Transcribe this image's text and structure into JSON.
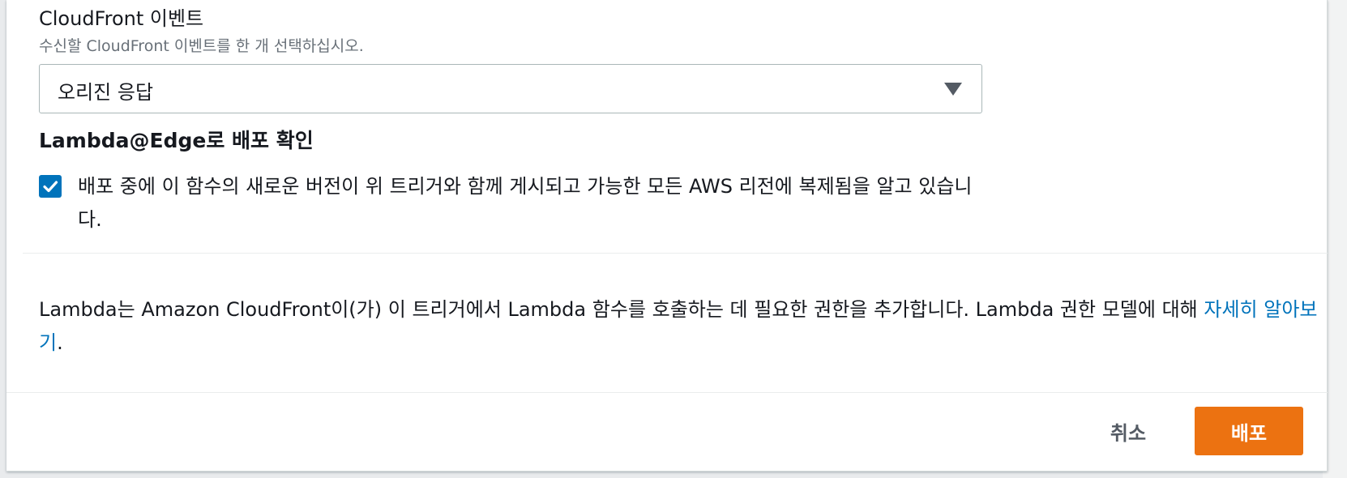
{
  "event_field": {
    "label": "CloudFront 이벤트",
    "description": "수신할 CloudFront 이벤트를 한 개 선택하십시오.",
    "selected_value": "오리진 응답"
  },
  "confirm_section": {
    "title": "Lambda@Edge로 배포 확인",
    "checked": true,
    "checkbox_label": "배포 중에 이 함수의 새로운 버전이 위 트리거와 함께 게시되고 가능한 모든 AWS 리전에 복제됨을 알고 있습니다."
  },
  "info": {
    "text": "Lambda는 Amazon CloudFront이(가) 이 트리거에서 Lambda 함수를 호출하는 데 필요한 권한을 추가합니다. Lambda 권한 모델에 대해 ",
    "link_text": "자세히 알아보기",
    "suffix": "."
  },
  "footer": {
    "cancel_label": "취소",
    "deploy_label": "배포"
  },
  "colors": {
    "primary_button": "#ec7211",
    "link": "#0073bb",
    "checkbox": "#0073bb"
  },
  "icons": {
    "select_caret": "caret-down-icon",
    "checkbox_mark": "checkmark-icon"
  }
}
